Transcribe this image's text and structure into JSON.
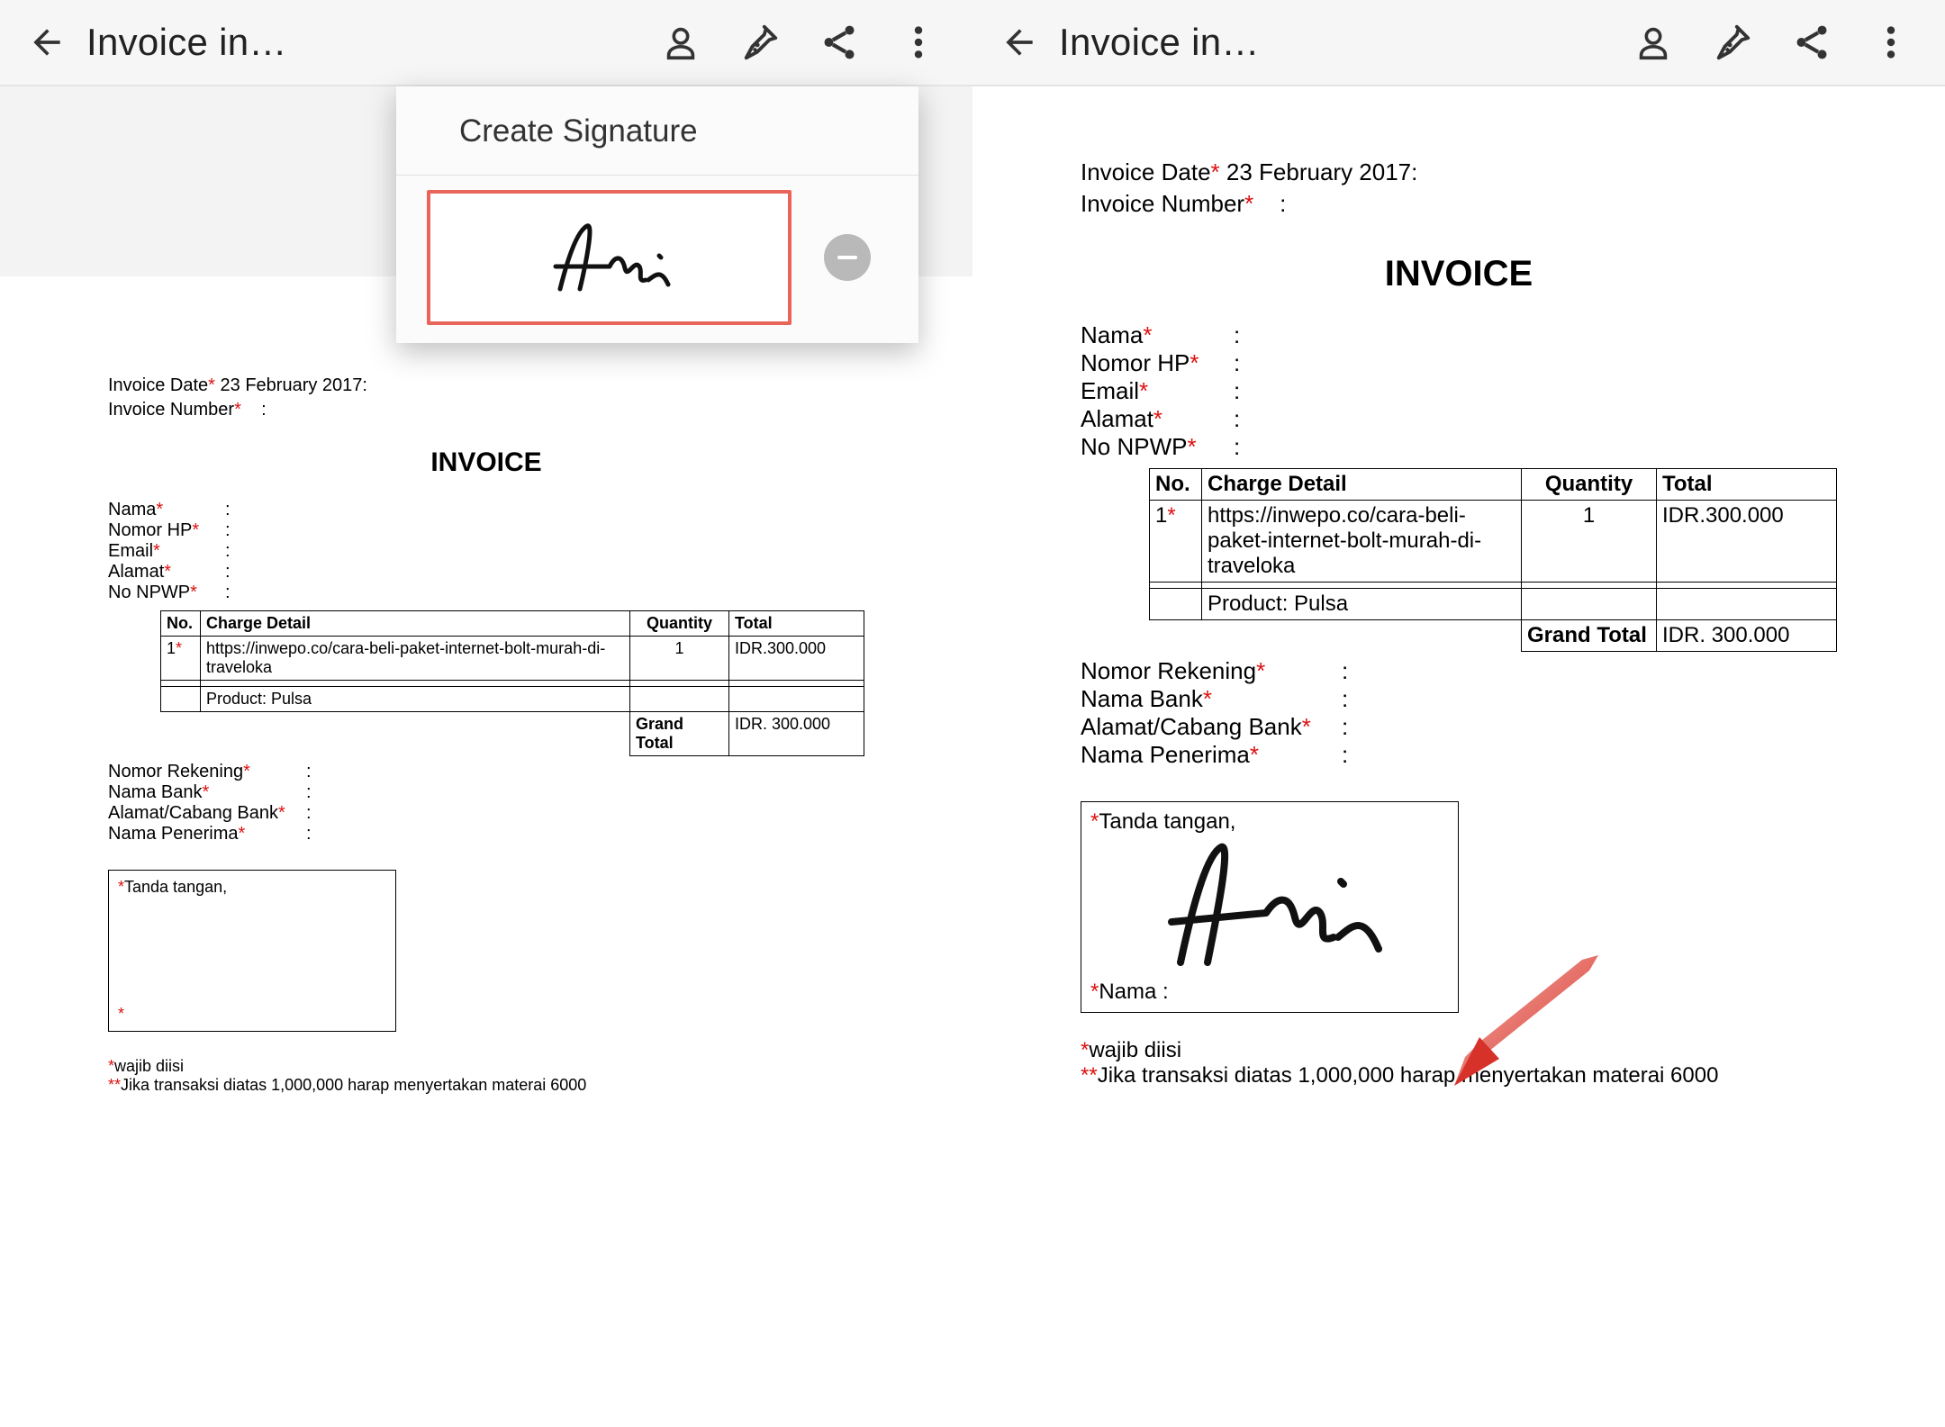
{
  "appbar": {
    "title": "Invoice in…"
  },
  "popover": {
    "title": "Create Signature"
  },
  "doc": {
    "invoice_date_label": "Invoice Date",
    "invoice_date_value": "23 February 2017:",
    "invoice_number_label": "Invoice Number",
    "heading": "INVOICE",
    "fields": {
      "nama": "Nama",
      "nomor_hp": "Nomor HP",
      "email": "Email",
      "alamat": "Alamat",
      "no_npwp": "No NPWP"
    },
    "table": {
      "headers": {
        "no": "No.",
        "detail": "Charge Detail",
        "qty": "Quantity",
        "total": "Total"
      },
      "rows": [
        {
          "no": "1",
          "detail": "https://inwepo.co/cara-beli-paket-internet-bolt-murah-di-traveloka",
          "qty": "1",
          "total": "IDR.300.000"
        }
      ],
      "product_label": "Product: Pulsa",
      "grand_total_label": "Grand Total",
      "grand_total_value": "IDR. 300.000"
    },
    "bank": {
      "rekening": "Nomor Rekening",
      "nama_bank": "Nama Bank",
      "cabang": "Alamat/Cabang Bank",
      "penerima": "Nama Penerima"
    },
    "sig_top": "Tanda tangan,",
    "sig_bottom_left": "Nama :",
    "sig_bottom_left_star": "*",
    "notes": {
      "n1": "wajib diisi",
      "n2": "Jika transaksi diatas 1,000,000 harap menyertakan materai 6000"
    }
  }
}
